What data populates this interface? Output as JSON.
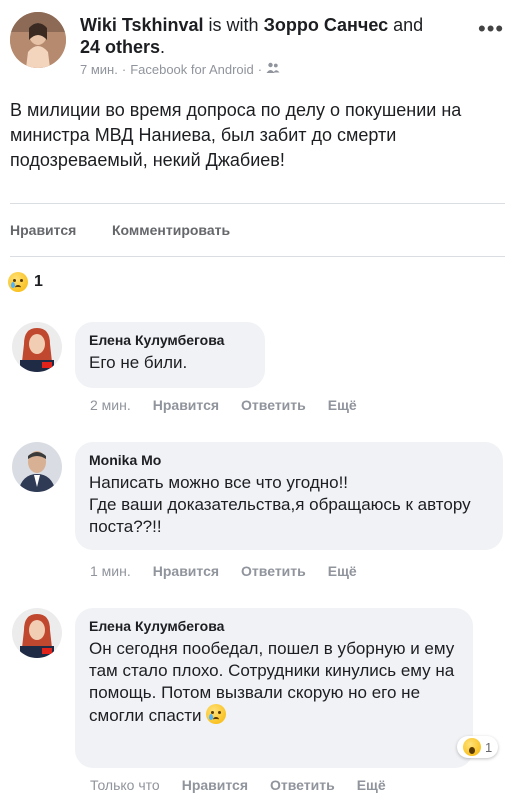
{
  "post": {
    "author": "Wiki Tskhinval",
    "with_word": " is with ",
    "tagged": "Зорро Санчес",
    "and_word": " and",
    "others": "24 others",
    "others_suffix": ".",
    "time": "7 мин.",
    "separator": "·",
    "source": "Facebook for Android",
    "separator2": "·",
    "audience_icon": "friends-icon",
    "more_icon": "more-icon",
    "more_glyph": "•••",
    "text": "В милиции во время допроса по делу о покушении на министра МВД Наниева, был забит до смерти подозреваемый, некий Джабиев!"
  },
  "actions": {
    "like": "Нравится",
    "comment": "Комментировать"
  },
  "reactions": {
    "icon": "crying-face-icon",
    "count": "1"
  },
  "comments": [
    {
      "name": "Елена Кулумбегова",
      "text": "Его не били.",
      "time": "2 мин.",
      "like": "Нравится",
      "reply": "Ответить",
      "more": "Ещё"
    },
    {
      "name": "Monika Mo",
      "text": "Написать можно все что угодно!!\nГде ваши доказательства,я обращаюсь к автору поста??!!",
      "time": "1 мин.",
      "like": "Нравится",
      "reply": "Ответить",
      "more": "Ещё"
    },
    {
      "name": "Елена Кулумбегова",
      "text": "Он сегодня пообедал, пошел в уборную и ему там стало плохо. Сотрудники кинулись ему на помощь. Потом вызвали скорую но его не смогли спасти",
      "time": "Только что",
      "like": "Нравится",
      "reply": "Ответить",
      "more": "Ещё",
      "reaction_icon": "wow-face-icon",
      "reaction_count": "1"
    }
  ],
  "colors": {
    "bubble": "#f0f2f5",
    "meta_gray": "#90949c",
    "text": "#1c1e21"
  }
}
